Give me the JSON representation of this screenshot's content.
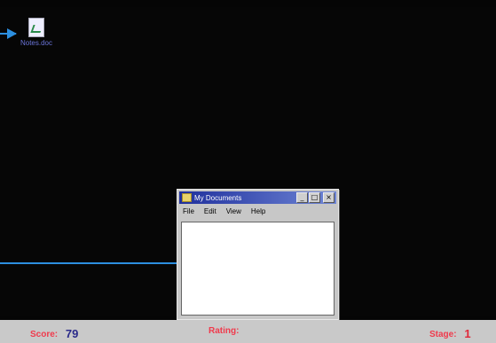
{
  "desktop": {
    "icon": {
      "label": "Notes.doc",
      "icon": "word-document-icon"
    }
  },
  "window": {
    "title": "My Documents",
    "controls": {
      "minimize": "_",
      "maximize": "□",
      "close": "×"
    },
    "menu": [
      "File",
      "Edit",
      "View",
      "Help"
    ]
  },
  "statusbar": {
    "score_label": "Score:",
    "score_value": "79",
    "rating_label": "Rating:",
    "stage_label": "Stage:",
    "stage_value": "1"
  },
  "colors": {
    "arrow": "#2c8fe0",
    "status_label": "#f03a4c",
    "score_value": "#2a2a8a",
    "stage_value": "#e0283a",
    "titlebar_start": "#1f2f9c",
    "titlebar_end": "#6f86d6"
  }
}
